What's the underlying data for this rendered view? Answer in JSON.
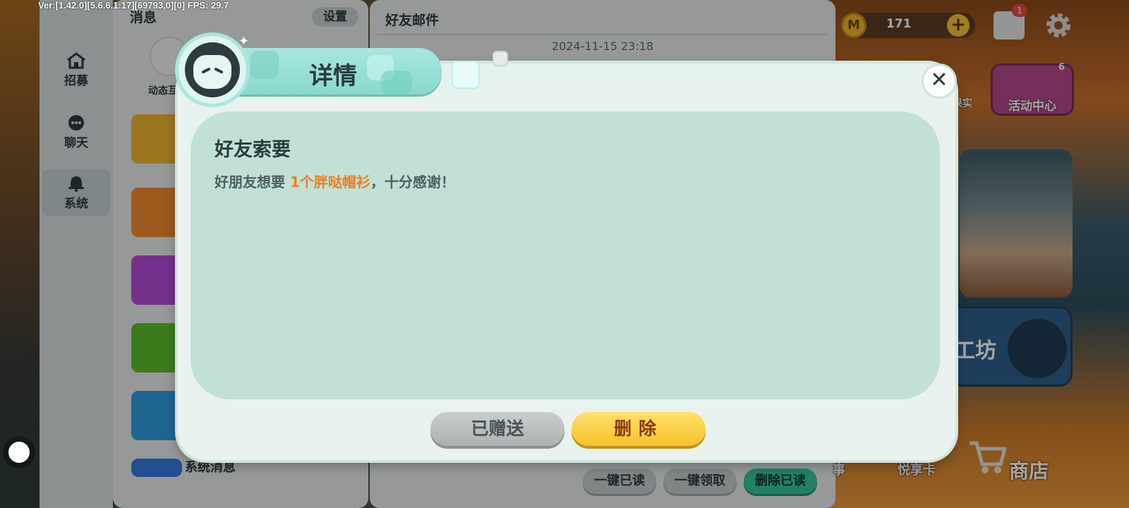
{
  "debug": {
    "text": "Ver:[1.42.0][5.6.6.1:17][69793,0][0] FPS: 29.7"
  },
  "left_nav": {
    "items": [
      {
        "label": "招募",
        "icon": "home-icon"
      },
      {
        "label": "聊天",
        "icon": "chat-bubble-icon"
      },
      {
        "label": "系统",
        "icon": "bell-icon",
        "active": true
      }
    ]
  },
  "message_panel": {
    "title": "消息",
    "settings_label": "设置",
    "dynamic_label": "动态互",
    "tiles": [
      {
        "icon": "friend-mail-icon",
        "color": "#f0b530"
      },
      {
        "icon": "megaphone-icon",
        "color": "#f08a2c"
      },
      {
        "icon": "gift-icon",
        "color": "#b44ad6"
      },
      {
        "icon": "pencil-ruler-icon",
        "color": "#5cbd2a"
      },
      {
        "icon": "envelope-icon",
        "color": "#2d9de0"
      },
      {
        "icon": "system-icon",
        "color": "#3a7ae0"
      }
    ],
    "last_tile_label": "系统消息"
  },
  "mail_panel": {
    "title": "好友邮件",
    "date": "2024-11-15 23:18",
    "actions": [
      {
        "label": "一键已读"
      },
      {
        "label": "一键领取"
      },
      {
        "label": "删除已读"
      }
    ]
  },
  "hud": {
    "coin_value": "171",
    "coin_symbol": "M",
    "plus": "+",
    "mail_badge": "1",
    "activity_label": "活动中心",
    "activity_badge": "6",
    "fruit_label": "果实",
    "workshop_label": "工坊",
    "shi_label": "事",
    "yue_label": "悦享卡",
    "shop_label": "商店"
  },
  "modal": {
    "title": "详情",
    "close": "✕",
    "heading": "好友索要",
    "body_prefix": "好朋友想要 ",
    "body_highlight": "1个胖哒帽衫",
    "body_suffix": "，十分感谢！",
    "highlight_color": "#f27c1a",
    "btn_given": "已赠送",
    "btn_delete": "删除"
  }
}
